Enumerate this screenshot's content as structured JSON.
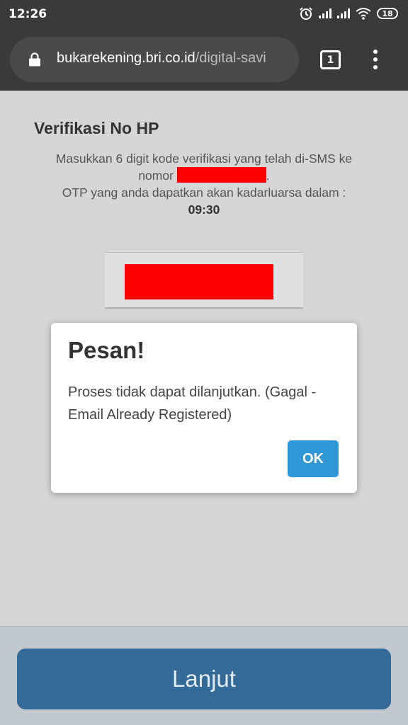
{
  "status_bar": {
    "time": "12:26",
    "battery": "18",
    "icons": [
      "alarm-icon",
      "signal-icon",
      "signal-icon",
      "wifi-icon",
      "battery-icon"
    ]
  },
  "browser": {
    "url_host": "bukarekening.bri.co.id",
    "url_path": "/digital-savi",
    "tab_count": "1"
  },
  "page": {
    "title": "Verifikasi No HP",
    "instruction_line1": "Masukkan 6 digit kode verifikasi yang telah di-SMS ke",
    "instruction_prefix": "nomor",
    "instruction_line2_end": ".",
    "instruction_line3": "OTP yang anda dapatkan akan kadarluarsa dalam :",
    "timer": "09:30"
  },
  "dialog": {
    "title": "Pesan!",
    "message": "Proses tidak dapat dilanjutkan. (Gagal - Email Already Registered)",
    "ok_label": "OK"
  },
  "footer": {
    "next_label": "Lanjut"
  },
  "colors": {
    "browser_bar": "#3a3a3a",
    "ok_button": "#2f97d6",
    "next_button": "#336a98",
    "redaction": "#ff0000"
  }
}
